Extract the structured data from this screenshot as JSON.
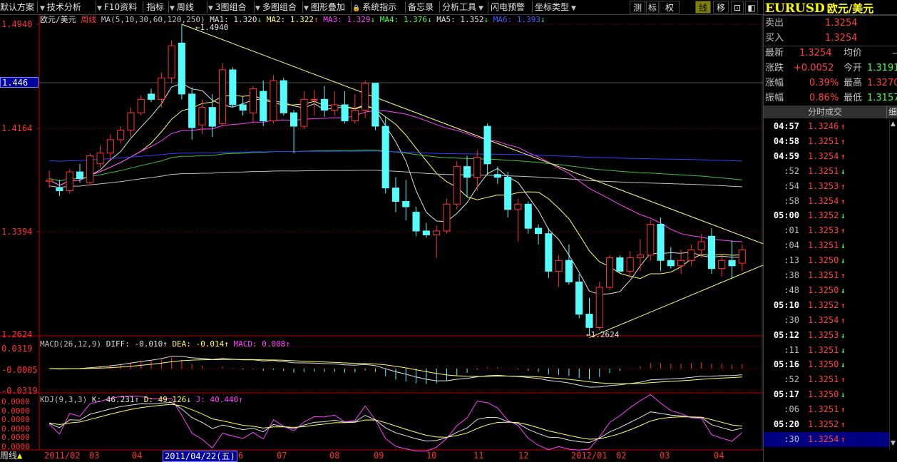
{
  "toolbar": {
    "items": [
      {
        "label": "默认方案"
      },
      {
        "label": "技术分析"
      },
      {
        "label": "F10资料"
      },
      {
        "label": "指标"
      },
      {
        "label": "周线"
      },
      {
        "label": "3图组合"
      },
      {
        "label": "多图组合"
      },
      {
        "label": "图形叠加"
      },
      {
        "label": "系统指示"
      },
      {
        "label": "备忘录"
      },
      {
        "label": "分析工具"
      },
      {
        "label": "闪电预警"
      },
      {
        "label": "坐标类型"
      }
    ],
    "right_buttons": [
      "测",
      "标",
      "权",
      "线",
      "移",
      "⊡",
      "◧"
    ],
    "active_right": "线"
  },
  "chart_header": {
    "symbol": "欧元/美元",
    "period": "周线",
    "ma_params": "MA(5,10,30,60,120,250)",
    "ma": [
      {
        "label": "MA1:",
        "value": "1.320",
        "dir": "↓",
        "color": "#e0e0e0"
      },
      {
        "label": "MA2:",
        "value": "1.322",
        "dir": "↑",
        "color": "#ffff60"
      },
      {
        "label": "MA3:",
        "value": "1.329",
        "dir": "↓",
        "color": "#ff40ff"
      },
      {
        "label": "MA4:",
        "value": "1.376",
        "dir": "↓",
        "color": "#40ff40"
      },
      {
        "label": "MA5:",
        "value": "1.352",
        "dir": "↓",
        "color": "#e0e0e0"
      },
      {
        "label": "MA6:",
        "value": "1.393",
        "dir": "↓",
        "color": "#4060ff"
      }
    ]
  },
  "price_axis": {
    "ticks": [
      "1.4940",
      "1.4164",
      "1.3394",
      "1.2624"
    ],
    "current_label": "1.446",
    "high_note": "1.4940",
    "low_note": "1.2624"
  },
  "macd": {
    "title": "MACD(26,12,9)",
    "diff": "DIFF: -0.010↑",
    "dea": "DEA: -0.014↑",
    "macd": "MACD: 0.008↑",
    "ticks": [
      "0.0319",
      "-0.0005",
      "-0.0319"
    ]
  },
  "kdj": {
    "title": "KDJ(9,3,3)",
    "k": "K: 46.231↑",
    "d": "D: 49.126↓",
    "j": "J: 40.440↑",
    "ticks": [
      "0.0000",
      "0.0000",
      "0.0000",
      "0.0000",
      "0.0000",
      "0.0000"
    ]
  },
  "time_axis": {
    "corner_label": "周线",
    "labels": [
      "2011/02",
      "03",
      "04",
      "2011/04/22(五)",
      "6",
      "07",
      "08",
      "09",
      "10",
      "11",
      "12",
      "2012/01",
      "02",
      "03",
      "04"
    ]
  },
  "quote": {
    "title_code": "EURUSD",
    "title_name": "欧元/美元",
    "sell_label": "卖出",
    "sell": "1.3254",
    "buy_label": "买入",
    "buy": "1.3254",
    "last_label": "最新",
    "last": "1.3254",
    "avg_label": "均价",
    "avg": "—",
    "chg_label": "涨跌",
    "chg": "+0.0052",
    "open_label": "今开",
    "open": "1.3191",
    "pct_label": "涨幅",
    "pct": "0.39%",
    "high_label": "最高",
    "high": "1.3270",
    "amp_label": "振幅",
    "amp": "0.86%",
    "low_label": "最低",
    "low": "1.3157",
    "ticks_title": "分时成交",
    "detail_button": "细"
  },
  "ticks": [
    {
      "time": "04:57",
      "price": "1.3246",
      "dir": "up"
    },
    {
      "time": "04:58",
      "price": "1.3251",
      "dir": "up"
    },
    {
      "time": "04:59",
      "price": "1.3254",
      "dir": "up"
    },
    {
      "time": ":52",
      "price": "1.3251",
      "dir": "down"
    },
    {
      "time": ":54",
      "price": "1.3253",
      "dir": "up"
    },
    {
      "time": ":58",
      "price": "1.3254",
      "dir": "up"
    },
    {
      "time": "05:00",
      "price": "1.3252",
      "dir": "down"
    },
    {
      "time": ":01",
      "price": "1.3253",
      "dir": "up"
    },
    {
      "time": ":04",
      "price": "1.3251",
      "dir": "down"
    },
    {
      "time": ":13",
      "price": "1.3250",
      "dir": "down"
    },
    {
      "time": ":38",
      "price": "1.3251",
      "dir": "up"
    },
    {
      "time": ":48",
      "price": "1.3250",
      "dir": "down"
    },
    {
      "time": "05:10",
      "price": "1.3252",
      "dir": "up"
    },
    {
      "time": ":30",
      "price": "1.3254",
      "dir": "up"
    },
    {
      "time": "05:12",
      "price": "1.3253",
      "dir": "down"
    },
    {
      "time": ":11",
      "price": "1.3251",
      "dir": "down"
    },
    {
      "time": "05:16",
      "price": "1.3250",
      "dir": "down"
    },
    {
      "time": ":52",
      "price": "1.3251",
      "dir": "up"
    },
    {
      "time": "05:17",
      "price": "1.3250",
      "dir": "down"
    },
    {
      "time": ":06",
      "price": "1.3251",
      "dir": "up"
    },
    {
      "time": "05:20",
      "price": "1.3252",
      "dir": "up"
    },
    {
      "time": ":30",
      "price": "1.3254",
      "dir": "up",
      "selected": true
    }
  ],
  "colors": {
    "up": "#ff3232",
    "down": "#54fcfc",
    "grid": "#800000",
    "axis": "#c00000",
    "ma_white": "#e0e0e0",
    "ma_yellow": "#ffff60",
    "ma_magenta": "#ff40ff",
    "ma_green": "#40c040",
    "ma_blue": "#3040ff",
    "ma_gray": "#c0c0c0"
  },
  "chart_data": {
    "type": "candlestick",
    "period": "weekly",
    "ylim": [
      1.2624,
      1.494
    ],
    "candles": [
      [
        1.377,
        1.385,
        1.372,
        1.378
      ],
      [
        1.372,
        1.378,
        1.366,
        1.37
      ],
      [
        1.37,
        1.386,
        1.368,
        1.384
      ],
      [
        1.384,
        1.39,
        1.376,
        1.379
      ],
      [
        1.376,
        1.398,
        1.375,
        1.396
      ],
      [
        1.39,
        1.404,
        1.387,
        1.398
      ],
      [
        1.398,
        1.412,
        1.392,
        1.408
      ],
      [
        1.408,
        1.418,
        1.405,
        1.415
      ],
      [
        1.415,
        1.432,
        1.41,
        1.428
      ],
      [
        1.428,
        1.441,
        1.426,
        1.438
      ],
      [
        1.442,
        1.446,
        1.436,
        1.438
      ],
      [
        1.438,
        1.458,
        1.432,
        1.454
      ],
      [
        1.454,
        1.482,
        1.45,
        1.478
      ],
      [
        1.48,
        1.494,
        1.438,
        1.442
      ],
      [
        1.442,
        1.447,
        1.408,
        1.417
      ],
      [
        1.419,
        1.438,
        1.412,
        1.432
      ],
      [
        1.432,
        1.442,
        1.41,
        1.418
      ],
      [
        1.42,
        1.465,
        1.418,
        1.46
      ],
      [
        1.46,
        1.462,
        1.432,
        1.434
      ],
      [
        1.434,
        1.44,
        1.426,
        1.43
      ],
      [
        1.428,
        1.448,
        1.42,
        1.446
      ],
      [
        1.444,
        1.452,
        1.418,
        1.422
      ],
      [
        1.422,
        1.456,
        1.42,
        1.452
      ],
      [
        1.452,
        1.454,
        1.426,
        1.428
      ],
      [
        1.428,
        1.43,
        1.398,
        1.418
      ],
      [
        1.418,
        1.444,
        1.416,
        1.438
      ],
      [
        1.438,
        1.445,
        1.426,
        1.438
      ],
      [
        1.438,
        1.448,
        1.425,
        1.43
      ],
      [
        1.43,
        1.444,
        1.426,
        1.434
      ],
      [
        1.434,
        1.444,
        1.42,
        1.422
      ],
      [
        1.422,
        1.442,
        1.42,
        1.43
      ],
      [
        1.43,
        1.452,
        1.424,
        1.45
      ],
      [
        1.45,
        1.45,
        1.415,
        1.418
      ],
      [
        1.418,
        1.425,
        1.368,
        1.372
      ],
      [
        1.372,
        1.38,
        1.354,
        1.362
      ],
      [
        1.362,
        1.378,
        1.348,
        1.358
      ],
      [
        1.354,
        1.358,
        1.336,
        1.34
      ],
      [
        1.34,
        1.346,
        1.335,
        1.337
      ],
      [
        1.337,
        1.344,
        1.32,
        1.34
      ],
      [
        1.34,
        1.364,
        1.338,
        1.36
      ],
      [
        1.36,
        1.392,
        1.356,
        1.388
      ],
      [
        1.388,
        1.396,
        1.365,
        1.38
      ],
      [
        1.38,
        1.4,
        1.37,
        1.395
      ],
      [
        1.418,
        1.42,
        1.382,
        1.39
      ],
      [
        1.382,
        1.388,
        1.375,
        1.38
      ],
      [
        1.38,
        1.384,
        1.35,
        1.356
      ],
      [
        1.356,
        1.364,
        1.332,
        1.36
      ],
      [
        1.36,
        1.362,
        1.338,
        1.342
      ],
      [
        1.342,
        1.345,
        1.33,
        1.338
      ],
      [
        1.338,
        1.342,
        1.305,
        1.31
      ],
      [
        1.31,
        1.322,
        1.298,
        1.318
      ],
      [
        1.318,
        1.33,
        1.3,
        1.302
      ],
      [
        1.302,
        1.308,
        1.275,
        1.278
      ],
      [
        1.278,
        1.29,
        1.262,
        1.268
      ],
      [
        1.268,
        1.302,
        1.266,
        1.298
      ],
      [
        1.298,
        1.322,
        1.296,
        1.32
      ],
      [
        1.32,
        1.322,
        1.308,
        1.31
      ],
      [
        1.31,
        1.325,
        1.305,
        1.32
      ],
      [
        1.32,
        1.334,
        1.31,
        1.322
      ],
      [
        1.322,
        1.348,
        1.318,
        1.345
      ],
      [
        1.345,
        1.35,
        1.31,
        1.318
      ],
      [
        1.318,
        1.328,
        1.312,
        1.314
      ],
      [
        1.314,
        1.326,
        1.308,
        1.318
      ],
      [
        1.318,
        1.33,
        1.314,
        1.326
      ],
      [
        1.326,
        1.338,
        1.32,
        1.332
      ],
      [
        1.336,
        1.342,
        1.308,
        1.312
      ],
      [
        1.312,
        1.322,
        1.306,
        1.318
      ],
      [
        1.318,
        1.333,
        1.304,
        1.314
      ],
      [
        1.316,
        1.33,
        1.31,
        1.326
      ]
    ]
  }
}
